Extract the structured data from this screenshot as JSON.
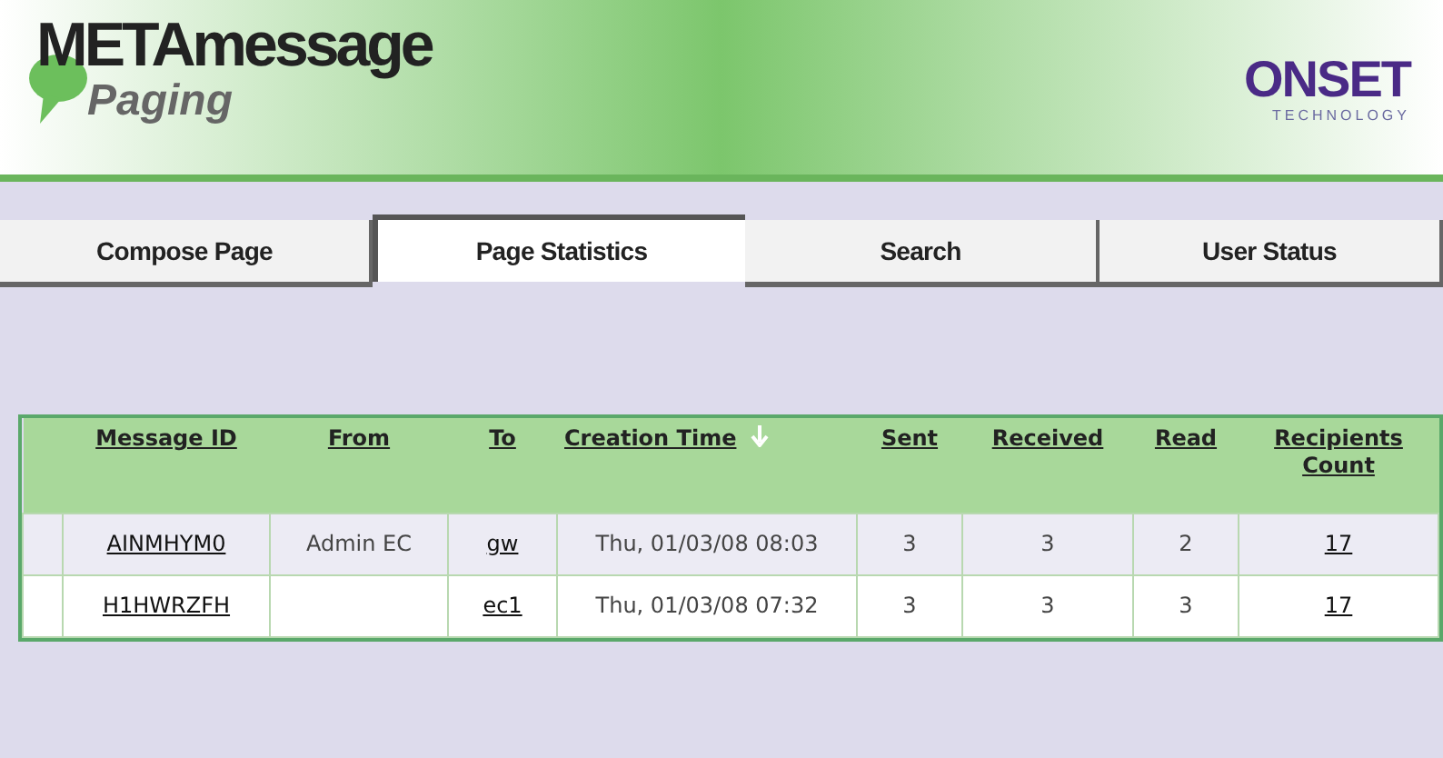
{
  "header": {
    "logo_title": "META",
    "logo_title_rest": "message",
    "logo_subtitle": "Paging",
    "company": "ONSET",
    "company_sub": "TECHNOLOGY"
  },
  "tabs": [
    {
      "label": "Compose Page",
      "selected": false
    },
    {
      "label": "Page Statistics",
      "selected": true
    },
    {
      "label": "Search",
      "selected": false
    },
    {
      "label": "User Status",
      "selected": false
    }
  ],
  "table": {
    "columns": [
      {
        "label": "Message ID",
        "sorted": false
      },
      {
        "label": "From",
        "sorted": false
      },
      {
        "label": "To",
        "sorted": false
      },
      {
        "label": "Creation Time",
        "sorted": true
      },
      {
        "label": "Sent",
        "sorted": false
      },
      {
        "label": "Received",
        "sorted": false
      },
      {
        "label": "Read",
        "sorted": false
      },
      {
        "label": "Recipients Count",
        "sorted": false
      }
    ],
    "rows": [
      {
        "cells": [
          {
            "text": "AINMHYM0",
            "link": true
          },
          {
            "text": "Admin EC",
            "link": false
          },
          {
            "text": "gw",
            "link": true
          },
          {
            "text": "Thu, 01/03/08 08:03",
            "link": false
          },
          {
            "text": "3",
            "link": false
          },
          {
            "text": "3",
            "link": false
          },
          {
            "text": "2",
            "link": false
          },
          {
            "text": "17",
            "link": true
          }
        ]
      },
      {
        "cells": [
          {
            "text": "H1HWRZFH",
            "link": true
          },
          null,
          {
            "text": "ec1",
            "link": true
          },
          {
            "text": "Thu, 01/03/08 07:32",
            "link": false
          },
          {
            "text": "3",
            "link": false
          },
          {
            "text": "3",
            "link": false
          },
          {
            "text": "3",
            "link": false
          },
          {
            "text": "17",
            "link": true
          }
        ]
      }
    ]
  }
}
